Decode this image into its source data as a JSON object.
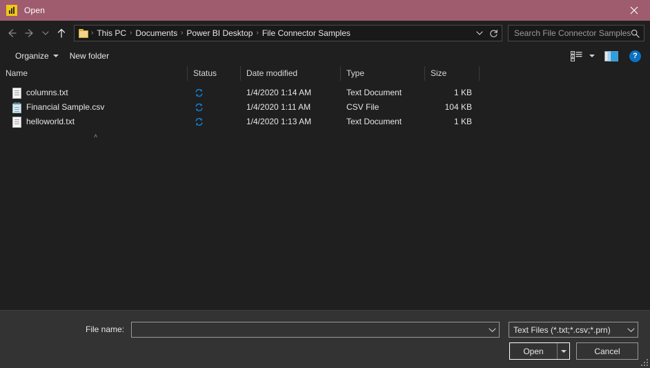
{
  "window": {
    "title": "Open",
    "app_icon": "power-bi-icon",
    "close_label": "✕",
    "titlebar_color": "#9e5c6e",
    "body_color": "#1f1f1f",
    "footer_color": "#333333",
    "accent_color": "#1683d8"
  },
  "nav": {
    "back": "back-arrow",
    "forward": "forward-arrow",
    "recent": "recent-locations-chevron",
    "up": "up-arrow",
    "back_glyph": "←",
    "forward_glyph": "→",
    "recent_glyph": "⌄",
    "up_glyph": "↑"
  },
  "address": {
    "folder_icon": "folder-icon",
    "crumbs": [
      {
        "label": "This PC"
      },
      {
        "label": "Documents"
      },
      {
        "label": "Power BI Desktop"
      },
      {
        "label": "File Connector Samples"
      }
    ],
    "separator": "›",
    "dropdown_glyph": "⌄",
    "refresh_glyph": "↻"
  },
  "search": {
    "placeholder": "Search File Connector Samples",
    "value": "",
    "icon": "search-icon"
  },
  "commandbar": {
    "organize": "Organize",
    "new_folder": "New folder",
    "view_icon": "view-options-icon",
    "pane_icon": "preview-pane-icon",
    "help_label": "?"
  },
  "filelist": {
    "sort_caret": "˄",
    "columns": [
      {
        "key": "name",
        "label": "Name"
      },
      {
        "key": "status",
        "label": "Status"
      },
      {
        "key": "date",
        "label": "Date modified"
      },
      {
        "key": "type",
        "label": "Type"
      },
      {
        "key": "size",
        "label": "Size"
      }
    ],
    "rows": [
      {
        "name": "columns.txt",
        "icon": "text-document-icon",
        "status_icon": "sync-icon",
        "date": "1/4/2020 1:14 AM",
        "type": "Text Document",
        "size": "1 KB"
      },
      {
        "name": "Financial Sample.csv",
        "icon": "csv-file-icon",
        "status_icon": "sync-icon",
        "date": "1/4/2020 1:11 AM",
        "type": "CSV File",
        "size": "104 KB"
      },
      {
        "name": "helloworld.txt",
        "icon": "text-document-icon",
        "status_icon": "sync-icon",
        "date": "1/4/2020 1:13 AM",
        "type": "Text Document",
        "size": "1 KB"
      }
    ]
  },
  "footer": {
    "filename_label": "File name:",
    "filename_value": "",
    "filename_placeholder": "",
    "filter_value": "Text Files (*.txt;*.csv;*.prn)",
    "open_label": "Open",
    "open_caret": "▾",
    "cancel_label": "Cancel",
    "combo_caret": "⌄",
    "resize_grip": "resize-grip"
  }
}
